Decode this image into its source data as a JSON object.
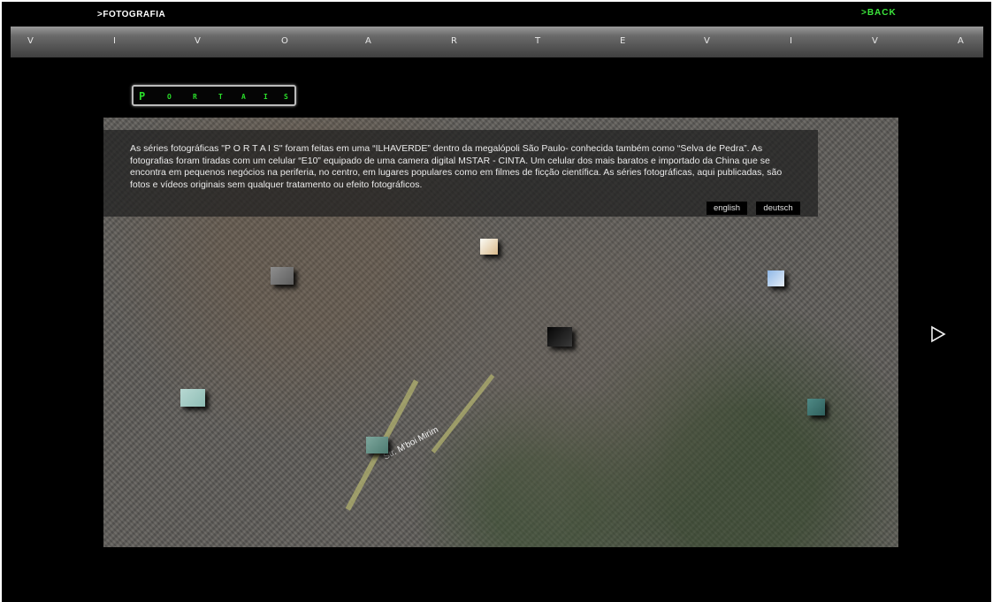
{
  "header": {
    "page_label": ">FOTOGRAFIA",
    "back_label": ">BACK"
  },
  "nav": {
    "letters": [
      "V",
      "I",
      "V",
      "O",
      "A",
      "R",
      "T",
      "E",
      "V",
      "I",
      "V",
      "A"
    ]
  },
  "section": {
    "letters": [
      "P",
      "O",
      "R",
      "T",
      "A",
      "I",
      "S"
    ]
  },
  "description": {
    "text": "As séries fotográficas \"P O R T A I S\" foram feitas em uma “ILHAVERDE” dentro da megalópoli São Paulo- conhecida também como “Selva de Pedra”. As fotografias foram tiradas com um celular “E10” equipado de uma camera digital MSTAR - CINTA. Um celular dos mais baratos e importado da China que se encontra em pequenos negócios na periferia, no centro, em lugares populares como em filmes de ficção científica. As séries fotográficas, aqui publicadas, são fotos e vídeos originais sem qualquer tratamento ou efeito fotográficos.",
    "english_label": "english",
    "deutsch_label": "deutsch"
  },
  "map": {
    "street_label": "Str. M'boi Mirim"
  },
  "thumbnails": [
    {
      "name": "thumb-sky-light",
      "colors": [
        "#fbfbf5",
        "#d9b98a"
      ]
    },
    {
      "name": "thumb-gray",
      "colors": [
        "#8e8e8e",
        "#5e5e5e"
      ]
    },
    {
      "name": "thumb-blue-sky",
      "colors": [
        "#8fb8e8",
        "#e6eef6"
      ]
    },
    {
      "name": "thumb-dark-light",
      "colors": [
        "#050505",
        "#3a3a3a"
      ]
    },
    {
      "name": "thumb-mint",
      "colors": [
        "#b7d8d2",
        "#8fbdb5"
      ]
    },
    {
      "name": "thumb-teal",
      "colors": [
        "#4f8a86",
        "#2f5f5c"
      ]
    },
    {
      "name": "thumb-window",
      "colors": [
        "#7fa89e",
        "#4c7a70"
      ]
    }
  ],
  "icons": {
    "next": "play-arrow-icon"
  }
}
